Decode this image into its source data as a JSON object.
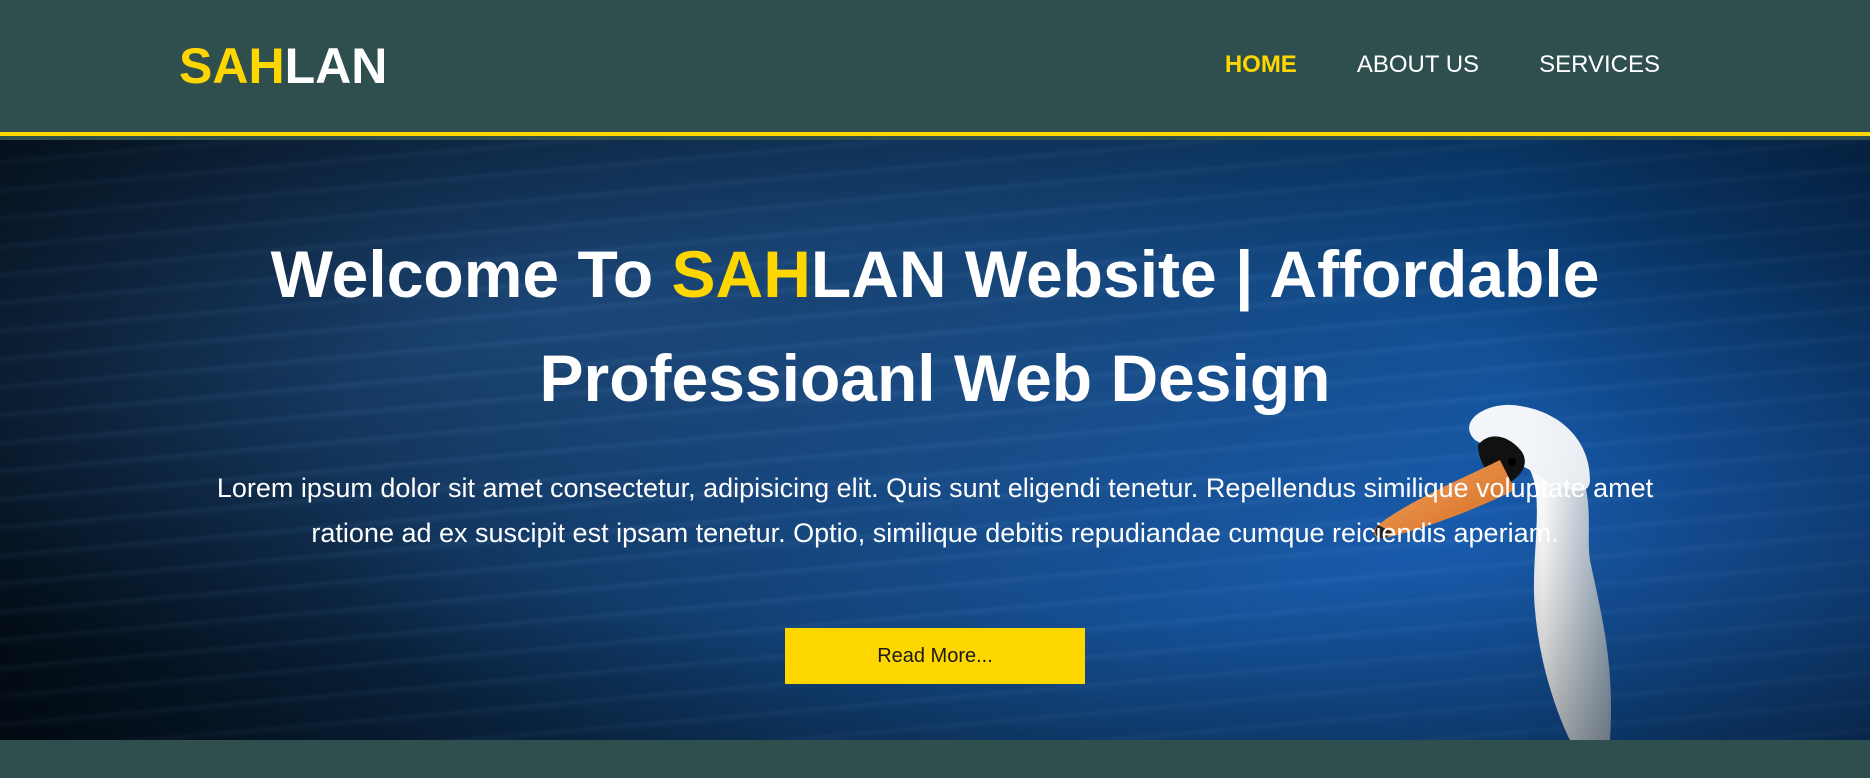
{
  "header": {
    "logo_accent": "SAH",
    "logo_rest": "LAN",
    "nav": [
      {
        "label": "HOME",
        "active": true
      },
      {
        "label": "ABOUT US",
        "active": false
      },
      {
        "label": "SERVICES",
        "active": false
      }
    ]
  },
  "hero": {
    "title_prefix": "Welcome To ",
    "title_accent": "SAH",
    "title_line1_rest": "LAN Website | Affordable",
    "title_line2": "Professioanl Web Design",
    "body": "Lorem ipsum dolor sit amet consectetur, adipisicing elit. Quis sunt eligendi tenetur. Repellendus similique voluptate amet ratione ad ex suscipit est ipsam tenetur. Optio, similique debitis repudiandae cumque reiciendis aperiam.",
    "button_label": "Read More..."
  },
  "colors": {
    "accent": "#ffd700",
    "header_bg": "#2f4f4f",
    "text": "#ffffff"
  },
  "icons": {
    "hero_image": "swan-on-water-image"
  }
}
